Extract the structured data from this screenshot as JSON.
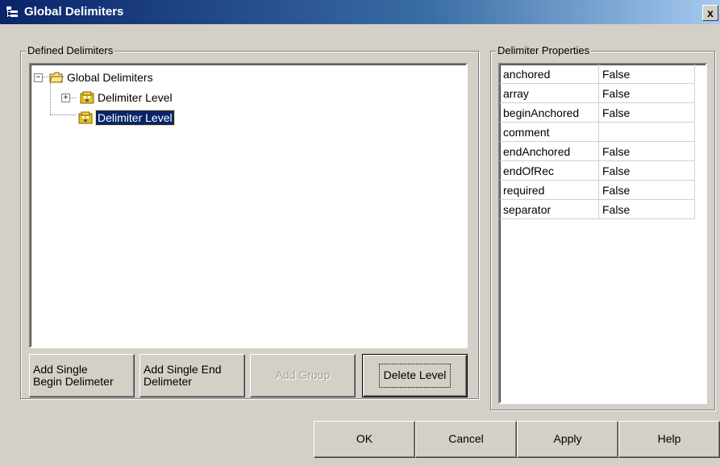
{
  "window": {
    "title": "Global Delimiters",
    "close_glyph": "x"
  },
  "defined": {
    "legend": "Defined Delimiters",
    "tree": {
      "root_label": "Global Delimiters",
      "children": [
        {
          "label": "Delimiter Level",
          "expander": "+"
        },
        {
          "label": "Delimiter Level"
        }
      ],
      "root_expander": "−"
    },
    "buttons": {
      "add_begin": "Add Single\nBegin Delimeter",
      "add_end": "Add Single End\nDelimeter",
      "add_group": "Add Group",
      "delete_level": "Delete Level"
    }
  },
  "properties": {
    "legend": "Delimiter Properties",
    "rows": [
      {
        "key": "anchored",
        "value": "False"
      },
      {
        "key": "array",
        "value": "False"
      },
      {
        "key": "beginAnchored",
        "value": "False"
      },
      {
        "key": "comment",
        "value": ""
      },
      {
        "key": "endAnchored",
        "value": "False"
      },
      {
        "key": "endOfRec",
        "value": "False"
      },
      {
        "key": "required",
        "value": "False"
      },
      {
        "key": "separator",
        "value": "False"
      }
    ]
  },
  "footer": {
    "ok": "OK",
    "cancel": "Cancel",
    "apply": "Apply",
    "help": "Help"
  },
  "colors": {
    "title_start": "#0a246a",
    "title_end": "#a6caf0",
    "selection": "#0a246a",
    "face": "#d4d0c8"
  }
}
